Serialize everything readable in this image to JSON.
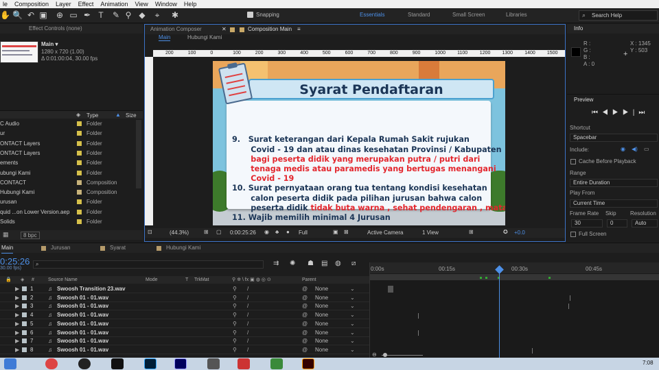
{
  "menu": [
    "le",
    "Composition",
    "Layer",
    "Effect",
    "Animation",
    "View",
    "Window",
    "Help"
  ],
  "toolbar": {
    "snapping": "Snapping",
    "workspaces": [
      "Essentials",
      "Standard",
      "Small Screen",
      "Libraries"
    ],
    "search_placeholder": "Search Help"
  },
  "project": {
    "effect_controls": "Effect Controls (none)",
    "item_name": "Main ▾",
    "item_res": "1280 x 720 (1.00)",
    "item_dur": "Δ 0:01:00:04, 30.00 fps",
    "col_type": "Type",
    "col_size": "Size",
    "items": [
      {
        "name": "C Audio",
        "type": "Folder"
      },
      {
        "name": "ur",
        "type": "Folder"
      },
      {
        "name": "ONTACT Layers",
        "type": "Folder"
      },
      {
        "name": "ONTACT Layers",
        "type": "Folder"
      },
      {
        "name": "ements",
        "type": "Folder"
      },
      {
        "name": "ubungi Kami",
        "type": "Folder"
      },
      {
        "name": "CONTACT",
        "type": "Composition"
      },
      {
        "name": "Hubungi Kami",
        "type": "Composition"
      },
      {
        "name": "urusan",
        "type": "Folder"
      },
      {
        "name": "quid ...on Lower Version.aep",
        "type": "Folder"
      },
      {
        "name": "Solids",
        "type": "Folder"
      },
      {
        "name": "",
        "type": "Composition"
      }
    ],
    "bpc": "8 bpc"
  },
  "comp": {
    "tab1": "Animation Composer",
    "tab2": "Composition Main",
    "sub1": "Main",
    "sub2": "Hubungi Kami",
    "ruler": [
      "200",
      "100",
      "0",
      "100",
      "200",
      "300",
      "400",
      "500",
      "600",
      "700",
      "800",
      "900",
      "1000",
      "1100",
      "1200",
      "1300",
      "1400",
      "1500"
    ],
    "slide_title": "Syarat Pendaftaran",
    "lines": [
      {
        "t": "9.   Surat keterangan dari Kepala Rumah Sakit rujukan",
        "red": false
      },
      {
        "t": "       Covid - 19 dan atau dinas kesehatan Provinsi / Kabupaten",
        "red": false
      },
      {
        "t": "       bagi peserta didik yang merupakan putra / putri dari",
        "red": true
      },
      {
        "t": "       tenaga medis atau paramedis yang bertugas menangani",
        "red": true
      },
      {
        "t": "       Covid - 19",
        "red": true
      },
      {
        "t": "10. Surat pernyataan orang tua tentang kondisi kesehatan",
        "red": false
      },
      {
        "t": "       calon peserta didik pada pilihan jurusan bahwa calon",
        "red": false
      }
    ],
    "line_mixed_a": "       peserta didik ",
    "line_mixed_b": "tidak buta warna , sehat pendengaran , mata & gigi",
    "line_last": "11. Wajib memilih minimal 4 Jurusan",
    "footer": {
      "zoom": "(44.3%)",
      "time": "0:00:25:26",
      "quality": "Full",
      "camera": "Active Camera",
      "view": "1 View",
      "offset": "+0.0"
    }
  },
  "info": {
    "title": "Info",
    "r": "R :",
    "g": "G :",
    "b": "B :",
    "a": "A : 0",
    "x": "X : 1345",
    "y": "Y : 503"
  },
  "preview": {
    "title": "Preview",
    "shortcut": "Shortcut",
    "shortcut_val": "Spacebar",
    "include": "Include:",
    "cache": "Cache Before Playback",
    "range": "Range",
    "range_val": "Entire Duration",
    "playfrom": "Play From",
    "playfrom_val": "Current Time",
    "framerate": "Frame Rate",
    "skip": "Skip",
    "resolution": "Resolution",
    "fr_val": "30",
    "skip_val": "0",
    "res_val": "Auto",
    "fullscreen": "Full Screen"
  },
  "timeline": {
    "tabs": [
      "Main",
      "Jurusan",
      "Syarat",
      "Hubungi Kami"
    ],
    "time": "0:25:26",
    "fps": "30.00 fps)",
    "cols": {
      "num": "#",
      "source": "Source Name",
      "mode": "Mode",
      "t": "T",
      "trk": "TrkMat",
      "parent": "Parent"
    },
    "ticks": [
      "0:00s",
      "00:15s",
      "00:30s",
      "00:45s"
    ],
    "layers": [
      {
        "n": "1",
        "name": "Swoosh Transition 23.wav",
        "p": "None"
      },
      {
        "n": "2",
        "name": "Swoosh 01 - 01.wav",
        "p": "None"
      },
      {
        "n": "3",
        "name": "Swoosh 01 - 01.wav",
        "p": "None"
      },
      {
        "n": "4",
        "name": "Swoosh 01 - 01.wav",
        "p": "None"
      },
      {
        "n": "5",
        "name": "Swoosh 01 - 01.wav",
        "p": "None"
      },
      {
        "n": "6",
        "name": "Swoosh 01 - 01.wav",
        "p": "None"
      },
      {
        "n": "7",
        "name": "Swoosh 01 - 01.wav",
        "p": "None"
      },
      {
        "n": "8",
        "name": "Swoosh 01 - 01.wav",
        "p": "None"
      }
    ]
  },
  "taskbar": {
    "clock": "7:08"
  }
}
